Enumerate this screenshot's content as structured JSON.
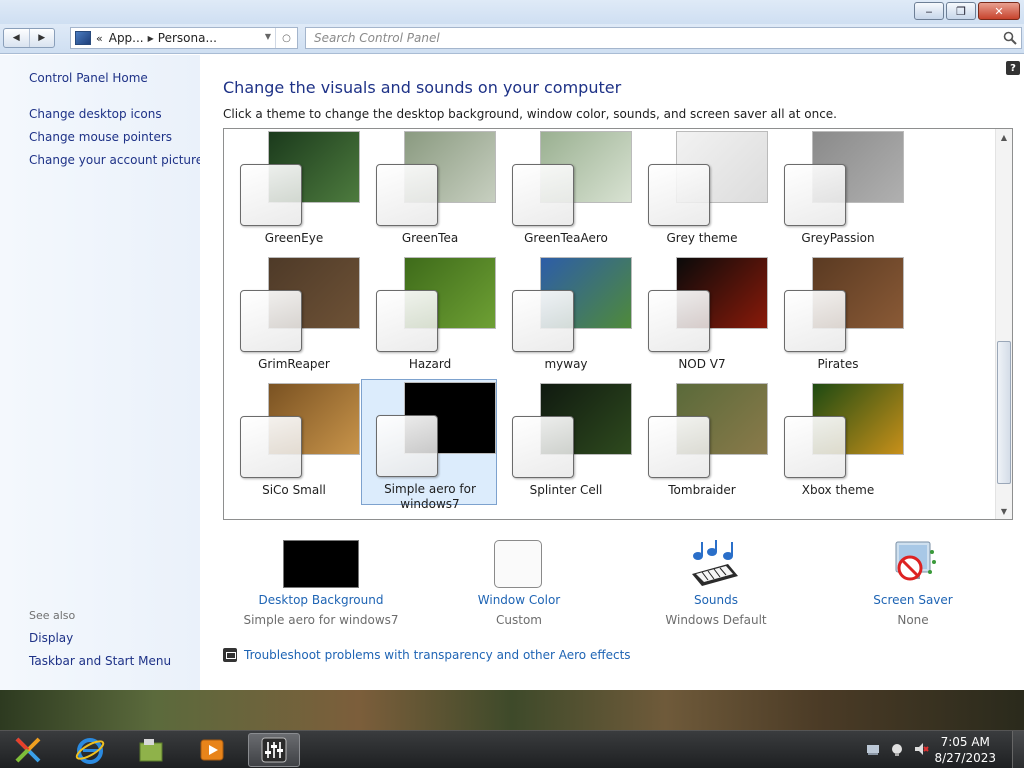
{
  "window": {
    "buttons": {
      "minimize_icon": "minimize-icon",
      "maximize_icon": "maximize-icon",
      "close_icon": "close-icon"
    }
  },
  "address": {
    "chevron": "«",
    "segments": [
      "App...",
      "Persona..."
    ],
    "search_placeholder": "Search Control Panel"
  },
  "sidebar": {
    "home": "Control Panel Home",
    "links": [
      "Change desktop icons",
      "Change mouse pointers",
      "Change your account picture"
    ],
    "see_also_label": "See also",
    "see_also": [
      "Display",
      "Taskbar and Start Menu"
    ]
  },
  "main": {
    "heading": "Change the visuals and sounds on your computer",
    "subheading": "Click a theme to change the desktop background, window color, sounds, and screen saver all at once.",
    "themes": [
      {
        "name": "GreenEye",
        "selected": false,
        "colors": [
          "#1b3a1c",
          "#4d7b3e",
          "#0e1a0e"
        ]
      },
      {
        "name": "GreenTea",
        "selected": false,
        "colors": [
          "#8a9a80",
          "#c7cfc0",
          "#556050"
        ]
      },
      {
        "name": "GreenTeaAero",
        "selected": false,
        "colors": [
          "#9ab091",
          "#d8e2d2",
          "#6b7f64"
        ]
      },
      {
        "name": "Grey theme",
        "selected": false,
        "colors": [
          "#f2f2f2",
          "#dcdcdc",
          "#c8c8c8"
        ]
      },
      {
        "name": "GreyPassion",
        "selected": false,
        "colors": [
          "#8a8a8a",
          "#b0b0b0",
          "#5f5f5f"
        ]
      },
      {
        "name": "GrimReaper",
        "selected": false,
        "colors": [
          "#4e3a28",
          "#6e5236",
          "#2e2216"
        ]
      },
      {
        "name": "Hazard",
        "selected": false,
        "colors": [
          "#3e6b1a",
          "#6ea034",
          "#1d3a0a"
        ]
      },
      {
        "name": "myway",
        "selected": false,
        "colors": [
          "#2d5da8",
          "#4f8a3a",
          "#c9d6e8"
        ]
      },
      {
        "name": "NOD V7",
        "selected": false,
        "colors": [
          "#0a0a0a",
          "#8a1a0a",
          "#c05a10"
        ]
      },
      {
        "name": "Pirates",
        "selected": false,
        "colors": [
          "#5a3a22",
          "#8a5a36",
          "#2e1c10"
        ]
      },
      {
        "name": "SiCo Small",
        "selected": false,
        "colors": [
          "#7a5222",
          "#c8944a",
          "#3a2410"
        ]
      },
      {
        "name": "Simple aero for windows7",
        "selected": true,
        "colors": [
          "#000000",
          "#000000",
          "#000000"
        ]
      },
      {
        "name": "Splinter Cell",
        "selected": false,
        "colors": [
          "#101a10",
          "#2e4a1e",
          "#0a0a0a"
        ]
      },
      {
        "name": "Tombraider",
        "selected": false,
        "colors": [
          "#5a6a3a",
          "#8a7a4a",
          "#3a3a22"
        ]
      },
      {
        "name": "Xbox theme",
        "selected": false,
        "colors": [
          "#1e4a12",
          "#c8901a",
          "#3e7a22"
        ]
      }
    ],
    "options": [
      {
        "link": "Desktop Background",
        "value": "Simple aero for windows7",
        "icon": "desktop-background-icon"
      },
      {
        "link": "Window Color",
        "value": "Custom",
        "icon": "window-color-icon"
      },
      {
        "link": "Sounds",
        "value": "Windows Default",
        "icon": "sounds-icon"
      },
      {
        "link": "Screen Saver",
        "value": "None",
        "icon": "screen-saver-icon"
      }
    ],
    "troubleshoot": "Troubleshoot problems with transparency and other Aero effects"
  },
  "taskbar": {
    "items": [
      "start-orb-icon",
      "internet-explorer-icon",
      "file-explorer-icon",
      "media-player-icon",
      "control-panel-icon"
    ],
    "time": "7:05 AM",
    "date": "8/27/2023"
  },
  "colors": {
    "link": "#1e64b4",
    "heading": "#1e3287",
    "selected_bg": "#dcecfc"
  }
}
